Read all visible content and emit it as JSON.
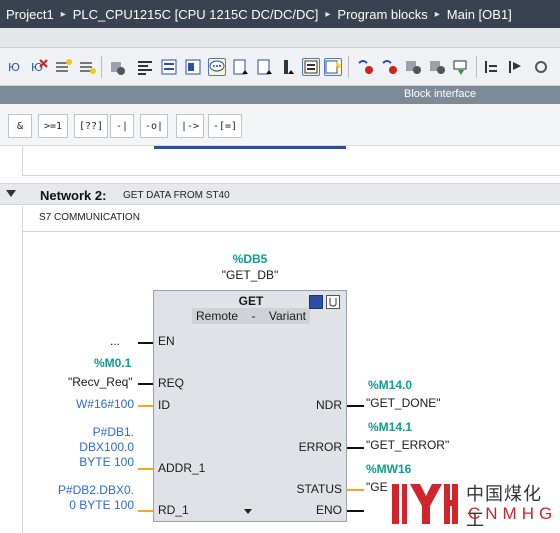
{
  "breadcrumb": {
    "items": [
      "Project1",
      "PLC_CPU1215C [CPU 1215C DC/DC/DC]",
      "Program blocks",
      "Main [OB1]"
    ],
    "separator": "▸"
  },
  "toolbar": {
    "icons": [
      "insert-network-icon",
      "delete-network-icon",
      "insert-row-icon",
      "append-row-icon",
      "download-icon",
      "absolute-operands-icon",
      "network-comments-icon",
      "favorites-icon",
      "box-comments-icon",
      "go-to-icon",
      "go-to-2-icon",
      "open-all-networks-icon",
      "close-all-networks-icon",
      "monitor-icon",
      "clear-ref-icon",
      "show-references-icon",
      "open-block-icon",
      "compile-icon",
      "list-icon",
      "settings-icon",
      "more-icon"
    ]
  },
  "block_interface_label": "Block interface",
  "lad_instructions": [
    "&",
    ">=1",
    "[??]",
    "-|",
    "-o|",
    "|->",
    "-[=]"
  ],
  "network": {
    "title": "Network 2:",
    "comment": "GET DATA FROM ST40",
    "network_comment": "S7 COMMUNICATION"
  },
  "block": {
    "db_address": "%DB5",
    "db_name": "\"GET_DB\"",
    "title": "GET",
    "param_left": "Remote",
    "param_dash": "-",
    "param_right": "Variant",
    "inputs": [
      "EN",
      "REQ",
      "ID",
      "ADDR_1",
      "RD_1"
    ],
    "outputs": [
      "NDR",
      "ERROR",
      "STATUS",
      "ENO"
    ]
  },
  "operands": {
    "en_value": "...",
    "req_address": "%M0.1",
    "req_tag": "\"Recv_Req\"",
    "id_value": "W#16#100",
    "addr1_line1": "P#DB1.",
    "addr1_line2": "DBX100.0",
    "addr1_line3": "BYTE 100",
    "rd1_line1": "P#DB2.DBX0.",
    "rd1_line2": "0 BYTE 100",
    "ndr_address": "%M14.0",
    "ndr_tag": "\"GET_DONE\"",
    "error_address": "%M14.1",
    "error_tag": "\"GET_ERROR\"",
    "status_address": "%MW16",
    "status_tag": "\"GE"
  },
  "watermark": {
    "chinese": "中国煤化工",
    "latin": "CNMHG"
  },
  "colors": {
    "breadcrumb_bg": "#384250",
    "address_teal": "#0aa08f",
    "constant_blue": "#2b6bd6",
    "wire_orange": "#f5a623",
    "watermark_red": "#d0252b"
  }
}
